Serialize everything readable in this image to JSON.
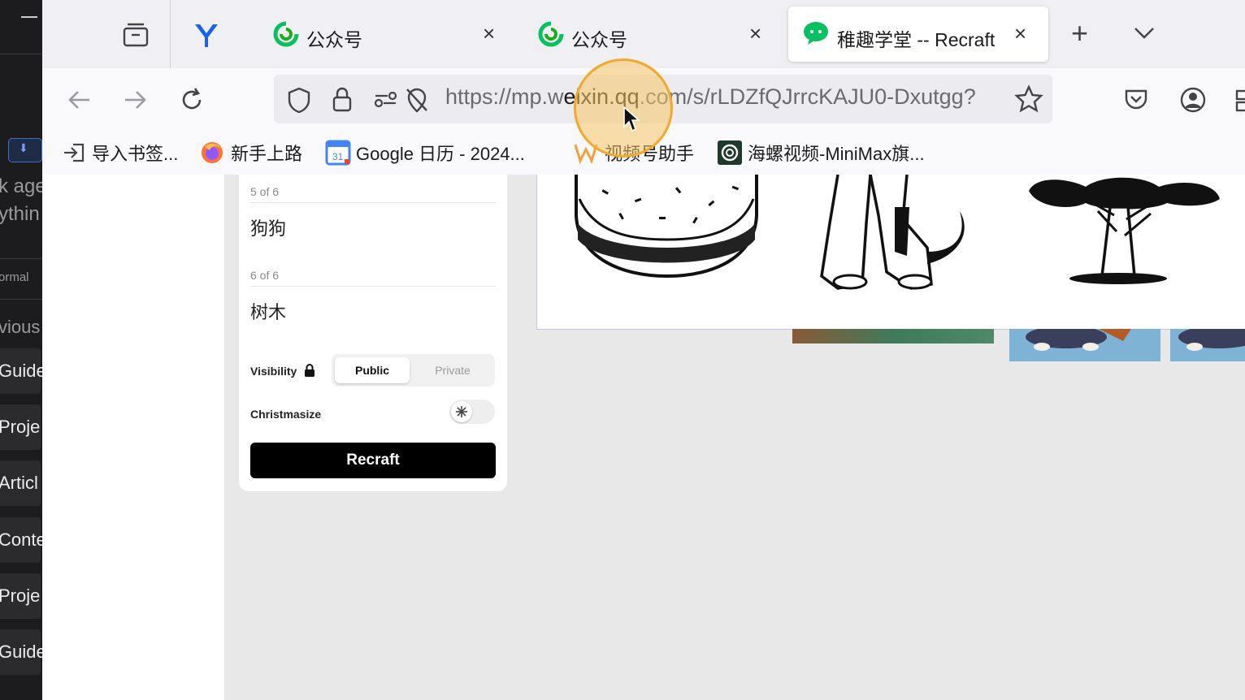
{
  "left_app": {
    "partial_lines": [
      "k age",
      "ythin",
      "ormal",
      "vious"
    ],
    "nav_items": [
      "Guide",
      "Proje",
      "Articl",
      "Conte",
      "Proje",
      "Guide"
    ]
  },
  "tabs": [
    {
      "label": "公众号",
      "close": "×"
    },
    {
      "label": "公众号",
      "close": "×"
    },
    {
      "label": "稚趣学堂 -- Recraft",
      "close": "×",
      "active": true
    }
  ],
  "tabbar": {
    "new_tab": "+",
    "list_all": "⌄"
  },
  "urlbar": {
    "prefix": "https://mp.w",
    "domain": "eixin.qq",
    "suffix": ".com/s/rLDZfQJrrcKAJU0-Dxutgg?"
  },
  "bookmarks": [
    {
      "label": "导入书签..."
    },
    {
      "label": "新手上路"
    },
    {
      "label": "Google 日历 - 2024..."
    },
    {
      "label": "视频号助手"
    },
    {
      "label": "海螺视频-MiniMax旗..."
    }
  ],
  "panel": {
    "items": [
      {
        "count": "5 of 6",
        "text": "狗狗"
      },
      {
        "count": "6 of 6",
        "text": "树木"
      }
    ],
    "visibility_label": "Visibility",
    "visibility_options": [
      "Public",
      "Private"
    ],
    "visibility_selected": "Public",
    "christmasize_label": "Christmasize",
    "christmasize_on": false,
    "recraft_button": "Recraft"
  },
  "colors": {
    "accent_purple": "#c9c4f2",
    "wechat_green": "#07c160",
    "cursor_highlight": "#f0a92c"
  }
}
